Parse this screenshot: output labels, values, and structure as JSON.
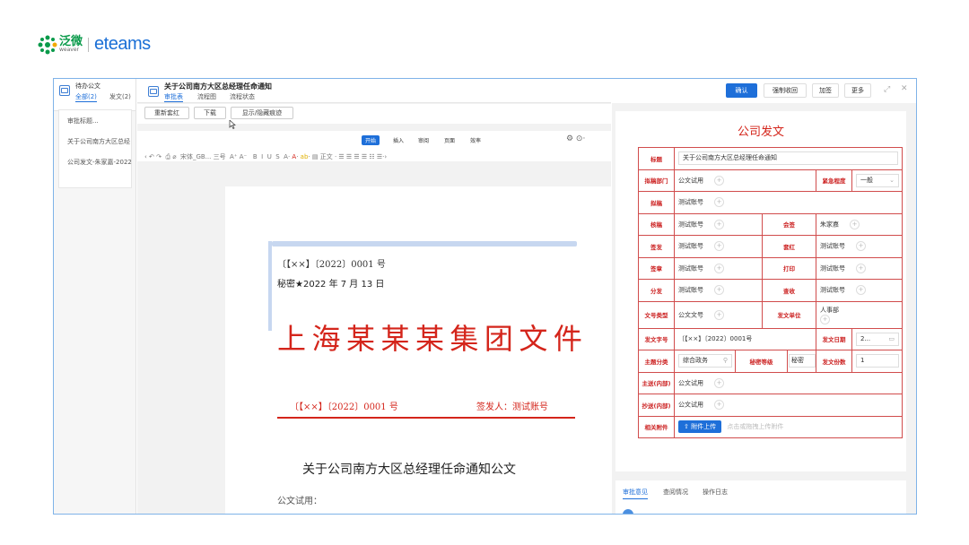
{
  "logo": {
    "cn": "泛微",
    "en": "weaver",
    "brand": "eteams"
  },
  "left_panel": {
    "title": "待办公文",
    "tabs": [
      "全部(2)",
      "发文(2)"
    ],
    "search_placeholder": "审批标题...",
    "items": [
      "关于公司南方大区总经",
      "公司发文-朱家嘉-2022"
    ]
  },
  "document": {
    "title": "关于公司南方大区总经理任命通知",
    "tabs": [
      "审批表",
      "流程图",
      "流程状态"
    ]
  },
  "toolbar": {
    "buttons": [
      "重新套红",
      "下载",
      "显示/隐藏痕迹"
    ]
  },
  "ribbon": {
    "tabs": [
      "开始",
      "插入",
      "审阅",
      "页面",
      "效率"
    ],
    "font_name": "宋体_GB...",
    "font_size": "三号",
    "para_style": "正文"
  },
  "page": {
    "doc_number": "〔【××】〔2022〕0001 号",
    "secret": "秘密★2022 年 7 月 13 日",
    "red_header": [
      "上",
      "海",
      "某",
      "某",
      "某",
      "集",
      "团",
      "文",
      "件"
    ],
    "doc_number2": "〔【××】〔2022〕0001 号",
    "signer": "签发人：测试账号",
    "doc_title": "关于公司南方大区总经理任命通知公文",
    "recipient": "公文试用："
  },
  "actions": {
    "buttons": [
      "确认",
      "强制收回",
      "加签",
      "更多"
    ]
  },
  "form": {
    "title": "公司发文",
    "rows": {
      "biaoti": {
        "label": "标题",
        "value": "关于公司南方大区总经理任命通知"
      },
      "nigao": {
        "label": "拟稿部门",
        "value": "公文试用",
        "label2": "紧急程度",
        "value2": "一般"
      },
      "ni": {
        "label": "拟稿",
        "value": "测试账号"
      },
      "hegao": {
        "label": "核稿",
        "value": "测试账号",
        "label2": "会签",
        "value2": "朱家嘉"
      },
      "qianfa": {
        "label": "签发",
        "value": "测试账号",
        "label2": "套红",
        "value2": "测试账号"
      },
      "qianzhang": {
        "label": "签章",
        "value": "测试账号",
        "label2": "打印",
        "value2": "测试账号"
      },
      "fenfa": {
        "label": "分发",
        "value": "测试账号",
        "label2": "查收",
        "value2": "测试账号"
      },
      "wenhao": {
        "label": "文号类型",
        "value": "公文文号",
        "label2": "发文单位",
        "value2": "人事部"
      },
      "zihao": {
        "label": "发文字号",
        "value": "〔【××】〔2022〕0001号",
        "label2": "发文日期",
        "value2": "2..."
      },
      "zhuti": {
        "label": "主题分类",
        "value": "综合政务",
        "label2": "秘密等级",
        "value2": "秘密",
        "label3": "发文份数",
        "value3": "1"
      },
      "zhusong": {
        "label": "主送(内部)",
        "value": "公文试用"
      },
      "chaosong": {
        "label": "抄送(内部)",
        "value": "公文试用"
      },
      "fujian": {
        "label": "相关附件",
        "button": "附件上传",
        "hint": "点击或拖拽上传附件"
      }
    }
  },
  "bottom_tabs": [
    "审批意见",
    "查阅情况",
    "操作日志"
  ],
  "colors": {
    "accent": "#1e6fd9",
    "red": "#d4251b",
    "brand_green": "#0a9a4a"
  }
}
